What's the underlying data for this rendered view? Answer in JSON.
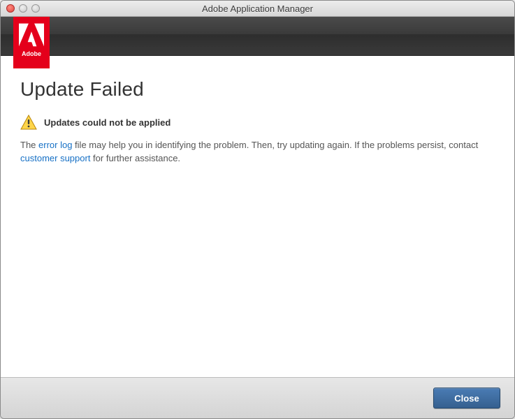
{
  "window": {
    "title": "Adobe Application Manager"
  },
  "brand": {
    "name": "Adobe"
  },
  "main": {
    "heading": "Update Failed",
    "subheading": "Updates could not be applied",
    "body_prefix": "The ",
    "error_log_link": "error log",
    "body_mid": " file may help you in identifying the problem. Then, try updating again. If the problems persist, contact ",
    "support_link": "customer support",
    "body_suffix": " for further assistance."
  },
  "footer": {
    "close_label": "Close"
  }
}
